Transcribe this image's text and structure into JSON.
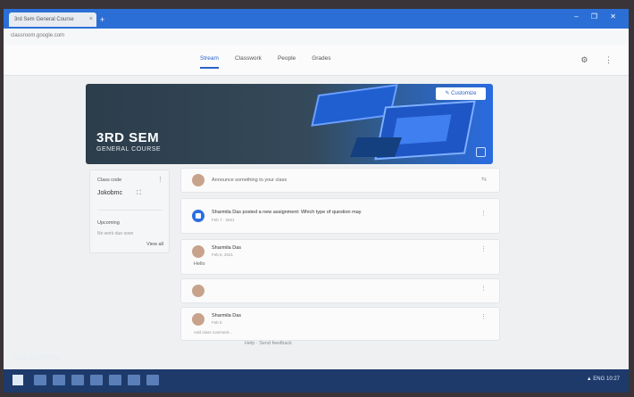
{
  "browser": {
    "tab_title": "3rd Sem General Course",
    "tab_close": "×",
    "new_tab": "+",
    "window_controls": "– ❐ ✕",
    "url": "classroom.google.com"
  },
  "nav": {
    "tabs": [
      {
        "label": "Stream",
        "active": true
      },
      {
        "label": "Classwork",
        "active": false
      },
      {
        "label": "People",
        "active": false
      },
      {
        "label": "Grades",
        "active": false
      }
    ],
    "icons": "⚙ ⋮"
  },
  "banner": {
    "title": "3RD SEM",
    "subtitle": "GENERAL COURSE",
    "customize_label": "✎ Customize"
  },
  "upcoming": {
    "label": "Class code",
    "more": "⋮",
    "value": "Jokobmc",
    "label2": "Upcoming",
    "text2": "No work due soon",
    "link": "View all"
  },
  "stream": {
    "announce_placeholder": "Announce something to your class",
    "post1_text": "Sharmila Das posted a new assignment: Which type of question may",
    "post1_sub": "Feb 7 · 2021",
    "post2_name": "Sharmila Das",
    "post2_sub": "Feb 6, 2021",
    "post2_body": "Hello",
    "post4_name": "Sharmila Das",
    "post4_sub": "Feb 5",
    "post4_comment": "Add class comment...",
    "kebab": "⋮",
    "announce_icon": "⇆"
  },
  "footer": {
    "link": "Help · Send feedback"
  },
  "overlay": {
    "watermark": "Shot on Redmi"
  },
  "taskbar": {
    "tray": "▲ ENG 10:27"
  }
}
